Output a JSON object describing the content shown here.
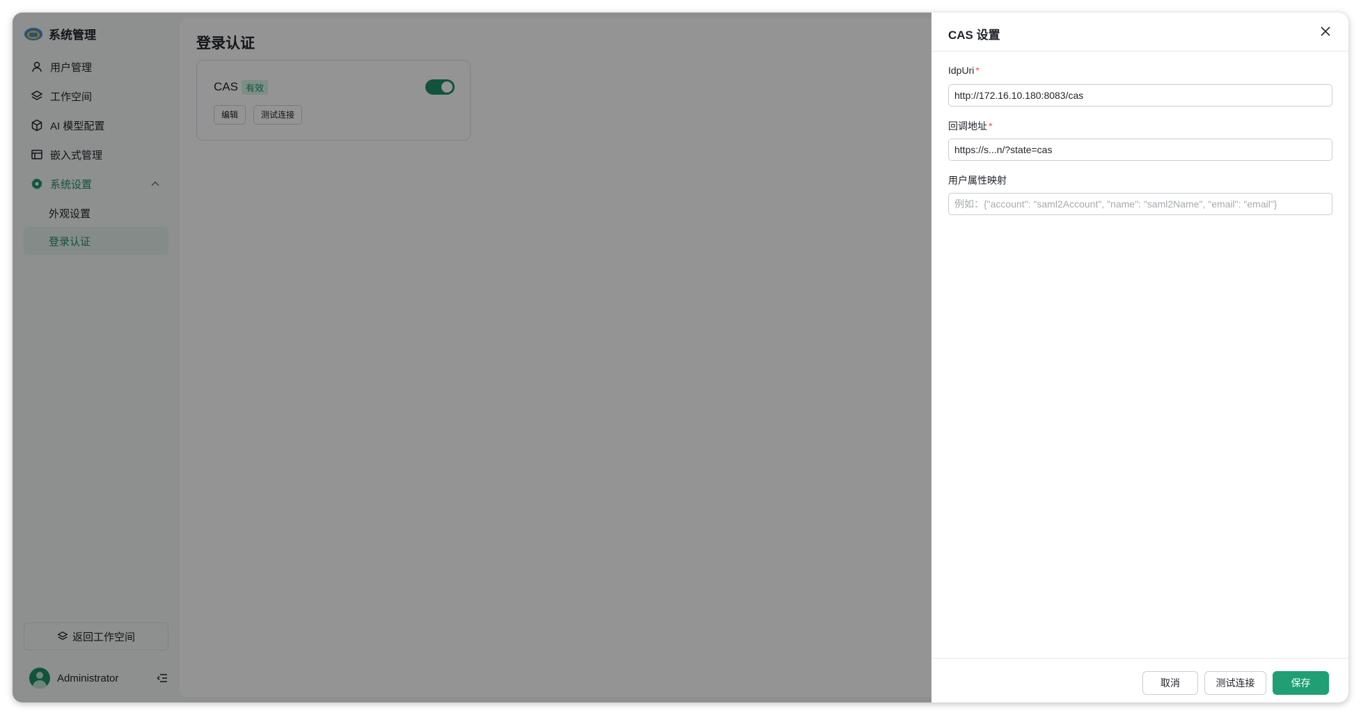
{
  "sidebar": {
    "title": "系统管理",
    "items": [
      {
        "label": "用户管理"
      },
      {
        "label": "工作空间"
      },
      {
        "label": "AI 模型配置"
      },
      {
        "label": "嵌入式管理"
      },
      {
        "label": "系统设置"
      }
    ],
    "sub_items": [
      {
        "label": "外观设置"
      },
      {
        "label": "登录认证"
      }
    ],
    "back_label": "返回工作空间",
    "user_name": "Administrator"
  },
  "main": {
    "title": "登录认证",
    "card": {
      "name": "CAS",
      "status_tag": "有效",
      "enabled": true,
      "edit_label": "编辑",
      "test_label": "测试连接"
    }
  },
  "drawer": {
    "title": "CAS 设置",
    "fields": [
      {
        "label": "IdpUri",
        "value": "http://172.16.10.180:8083/cas",
        "placeholder": ""
      },
      {
        "label": "回调地址",
        "value": "https://s...n/?state=cas",
        "placeholder": ""
      },
      {
        "label": "用户属性映射",
        "value": "",
        "placeholder": "例如：{\"account\": \"saml2Account\", \"name\": \"saml2Name\", \"email\": \"email\"}"
      }
    ],
    "required_mark": "*",
    "cancel_label": "取消",
    "test_label": "测试连接",
    "save_label": "保存"
  },
  "colors": {
    "accent": "#1f9f73",
    "required": "#f54a45"
  }
}
